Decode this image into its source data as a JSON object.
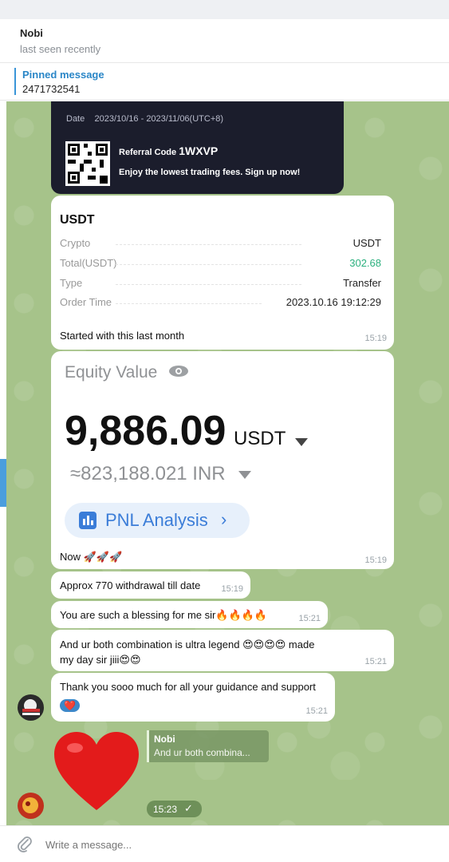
{
  "header": {
    "name": "Nobi",
    "status": "last seen recently"
  },
  "pinned": {
    "title": "Pinned message",
    "text": "2471732541"
  },
  "promo": {
    "date_label": "Date",
    "date_range": "2023/10/16 - 2023/11/06(UTC+8)",
    "referral_label": "Referral Code",
    "referral_code": "1WXVP",
    "tagline": "Enjoy the lowest trading fees. Sign up now!"
  },
  "order": {
    "title": "USDT",
    "rows": [
      {
        "key": "Crypto",
        "value": "USDT"
      },
      {
        "key": "Total(USDT)",
        "value": "302.68"
      },
      {
        "key": "Type",
        "value": "Transfer"
      },
      {
        "key": "Order Time",
        "value": "2023.10.16 19:12:29"
      }
    ],
    "caption": "Started with this last month",
    "time": "15:19"
  },
  "equity": {
    "label": "Equity Value",
    "value": "9,886.09",
    "unit": "USDT",
    "inr": "≈823,188.021 INR",
    "pnl": "PNL Analysis",
    "caption": "Now 🚀🚀🚀",
    "time": "15:19"
  },
  "messages": [
    {
      "text": "Approx 770  withdrawal till date",
      "time": "15:19"
    },
    {
      "text": "You are such a blessing for me sir🔥🔥🔥🔥",
      "time": "15:21"
    },
    {
      "text": "And ur both combination is ultra legend 😍😍😍😍 made my day sir jiii😍😍",
      "time": "15:21"
    },
    {
      "text": "Thank you sooo much for all your guidance and support",
      "time": "15:21",
      "reactions": "❤️"
    }
  ],
  "reply": {
    "name": "Nobi",
    "quote": "And ur both combina...",
    "time": "15:23"
  },
  "composer": {
    "placeholder": "Write a message..."
  },
  "colors": {
    "accent": "#3a95d8",
    "positive": "#2bb07e",
    "wallpaper": "#a6c38a",
    "promo_bg": "#1b1d2c"
  }
}
